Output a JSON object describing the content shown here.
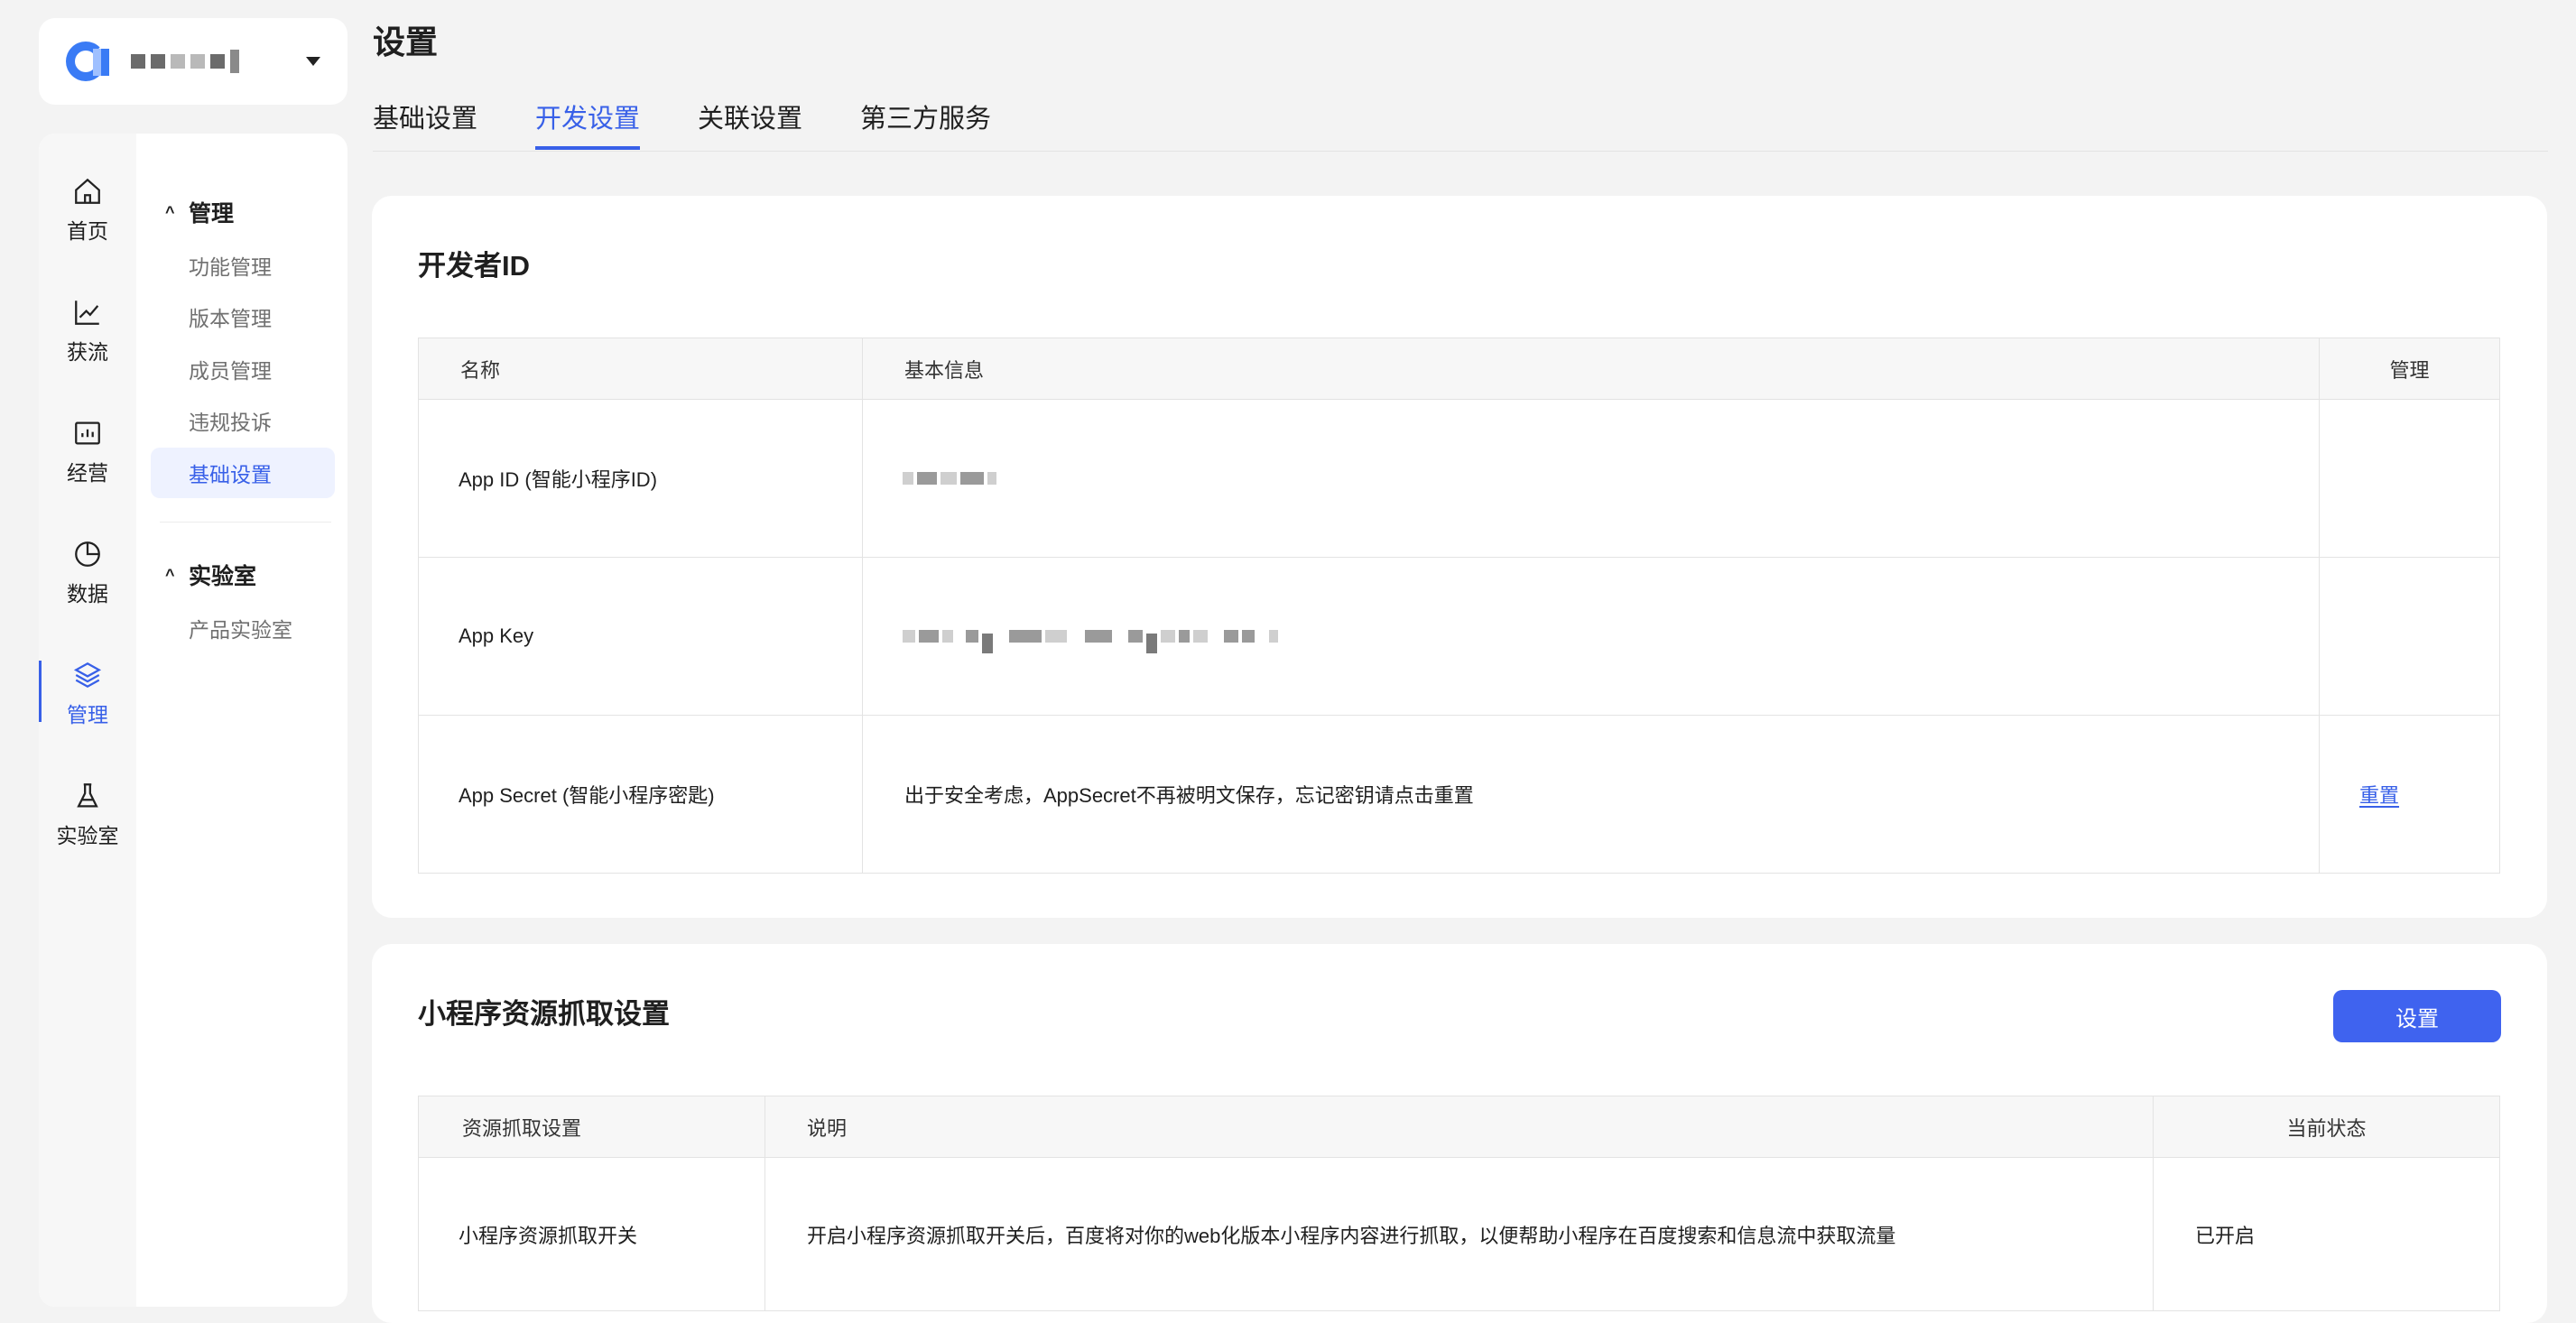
{
  "page": {
    "title": "设置"
  },
  "tabs": [
    {
      "label": "基础设置",
      "active": false
    },
    {
      "label": "开发设置",
      "active": true
    },
    {
      "label": "关联设置",
      "active": false
    },
    {
      "label": "第三方服务",
      "active": false
    }
  ],
  "rail": [
    {
      "label": "首页",
      "icon": "home-icon"
    },
    {
      "label": "获流",
      "icon": "line-chart-icon"
    },
    {
      "label": "经营",
      "icon": "dashboard-icon"
    },
    {
      "label": "数据",
      "icon": "pie-chart-icon"
    },
    {
      "label": "管理",
      "icon": "layers-icon",
      "active": true
    },
    {
      "label": "实验室",
      "icon": "flask-icon"
    }
  ],
  "menu": {
    "group1": {
      "label": "管理",
      "chevron": "^"
    },
    "items1": [
      {
        "label": "功能管理"
      },
      {
        "label": "版本管理"
      },
      {
        "label": "成员管理"
      },
      {
        "label": "违规投诉"
      },
      {
        "label": "基础设置",
        "active": true
      }
    ],
    "group2": {
      "label": "实验室",
      "chevron": "^"
    },
    "items2": [
      {
        "label": "产品实验室"
      }
    ]
  },
  "developer": {
    "title": "开发者ID",
    "headers": {
      "name": "名称",
      "info": "基本信息",
      "manage": "管理"
    },
    "rows": [
      {
        "name": "App ID (智能小程序ID)"
      },
      {
        "name": "App Key"
      },
      {
        "name": "App Secret (智能小程序密匙)",
        "info": "出于安全考虑，AppSecret不再被明文保存，忘记密钥请点击重置",
        "action": "重置"
      }
    ]
  },
  "crawl": {
    "title": "小程序资源抓取设置",
    "button": "设置",
    "headers": {
      "setting": "资源抓取设置",
      "desc": "说明",
      "status": "当前状态"
    },
    "rows": [
      {
        "setting": "小程序资源抓取开关",
        "desc": "开启小程序资源抓取开关后，百度将对你的web化版本小程序内容进行抓取，以便帮助小程序在百度搜索和信息流中获取流量",
        "status": "已开启"
      }
    ]
  },
  "colors": {
    "accent": "#3860e8",
    "button": "#3f63ef",
    "page_bg": "#f3f3f3"
  }
}
